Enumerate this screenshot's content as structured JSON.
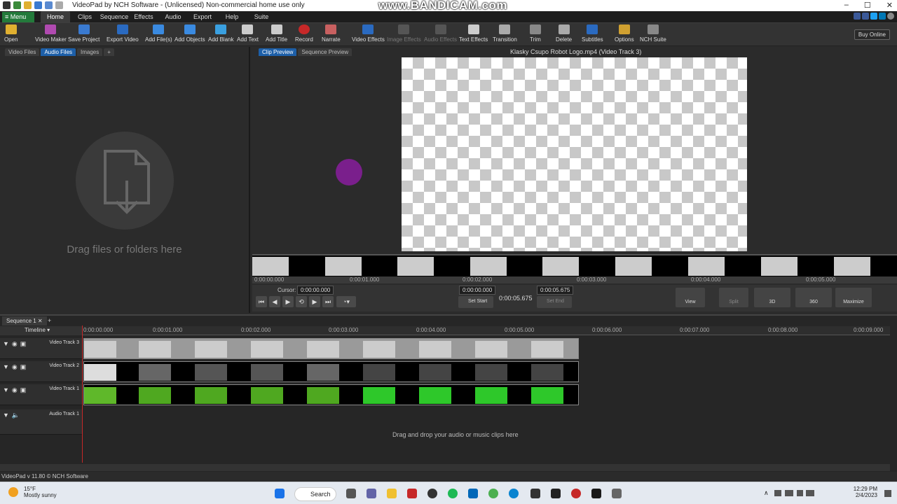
{
  "titlebar": {
    "title": "VideoPad by NCH Software - (Unlicensed) Non-commercial home use only",
    "watermark": "www.BANDICAM.com",
    "min": "–",
    "max": "☐",
    "close": "✕"
  },
  "menubar": {
    "menu_label": "≡ Menu",
    "tabs": [
      "Home",
      "Clips",
      "Sequence",
      "Effects",
      "Audio",
      "Export",
      "Help",
      "Suite"
    ],
    "active_tab": "Home"
  },
  "toolbar": {
    "buttons": [
      "Open",
      "Video Maker",
      "Save Project",
      "Export Video",
      "Add File(s)",
      "Add Objects",
      "Add Blank",
      "Add Text",
      "Add Title",
      "Record",
      "Narrate",
      "Video Effects",
      "Image Effects",
      "Audio Effects",
      "Text Effects",
      "Transition",
      "Trim",
      "Delete",
      "Subtitles",
      "Options",
      "NCH Suite"
    ],
    "buy_online": "Buy Online"
  },
  "leftpanel": {
    "tabs": [
      "Video Files",
      "Audio Files",
      "Images",
      "+"
    ],
    "active_tab": "Audio Files",
    "drop_text": "Drag files or folders here"
  },
  "preview": {
    "tabs": [
      "Clip Preview",
      "Sequence Preview"
    ],
    "active_tab": "Clip Preview",
    "title": "Klasky Csupo Robot Logo.mp4 (Video Track 3)",
    "ruler": [
      "0:00:00.000",
      "0:00:01.000",
      "0:00:02.000",
      "0:00:03.000",
      "0:00:04.000",
      "0:00:05.000"
    ],
    "cursor_label": "Cursor:",
    "cursor_value": "0:00:00.000",
    "start_value": "0:00:00.000",
    "set_start": "Set Start",
    "duration": "0:00:05.675",
    "end_value": "0:00:05.675",
    "set_end": "Set End",
    "right_buttons": [
      "View",
      "Split",
      "3D",
      "360",
      "Maximize"
    ]
  },
  "timeline": {
    "sequence_tab": "Sequence 1",
    "add_tab": "+",
    "header": "Timeline",
    "ruler": [
      "0:00:00.000",
      "0:00:01.000",
      "0:00:02.000",
      "0:00:03.000",
      "0:00:04.000",
      "0:00:05.000",
      "0:00:06.000",
      "0:00:07.000",
      "0:00:08.000",
      "0:00:09.000"
    ],
    "tracks": [
      "Video Track 3",
      "Video Track 2",
      "Video Track 1",
      "Audio Track 1"
    ],
    "audio_drop": "Drag and drop your audio or music clips here"
  },
  "statusbar": {
    "version": "VideoPad v 11.80 © NCH Software"
  },
  "taskbar": {
    "temp": "15°F",
    "weather": "Mostly sunny",
    "search": "Search",
    "time": "12:29 PM",
    "date": "2/4/2023"
  }
}
